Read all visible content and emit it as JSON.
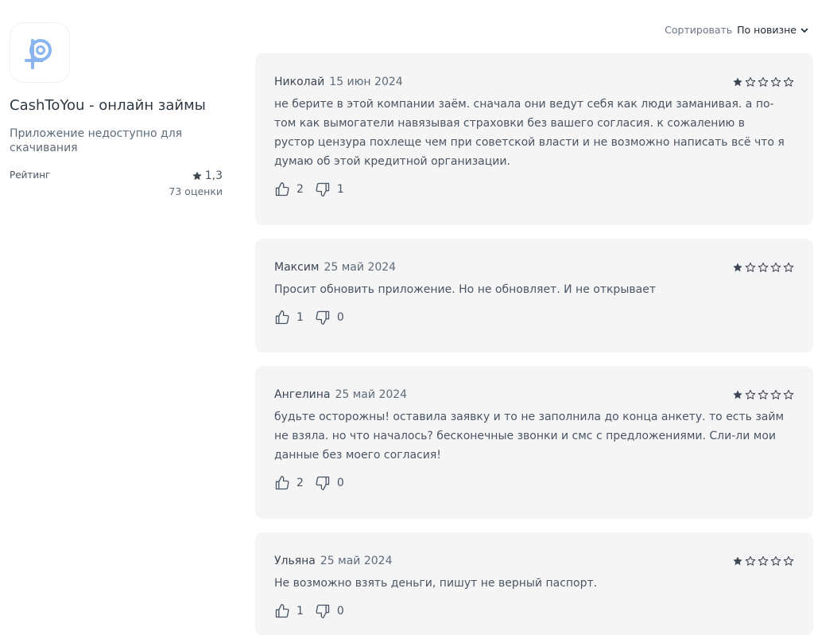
{
  "app": {
    "title": "CashToYou - онлайн займы",
    "status": "Приложение недоступно для скачивания",
    "rating_label": "Рейтинг",
    "rating_value": "1,3",
    "rating_count": "73 оценки",
    "icon": "cashtoyou-logo",
    "icon_color": "#8ab4f0"
  },
  "sort": {
    "label": "Сортировать",
    "value": "По новизне"
  },
  "reviews": [
    {
      "author": "Николай",
      "date": "15 июн 2024",
      "stars": 1,
      "text": "не берите в этой компании заём. сначала они ведут себя как люди заманивая. а по-том как вымогатели навязывая страховки без вашего согласия. к сожалению в рустор цензура похлеще чем при советской власти и не возможно написать всё что я думаю об этой кредитной организации.",
      "likes": "2",
      "dislikes": "1"
    },
    {
      "author": "Максим",
      "date": "25 май 2024",
      "stars": 1,
      "text": "Просит обновить приложение. Но не обновляет. И не открывает",
      "likes": "1",
      "dislikes": "0"
    },
    {
      "author": "Ангелина",
      "date": "25 май 2024",
      "stars": 1,
      "text": "будьте осторожны! оставила заявку и то не заполнила до конца анкету. то есть займ не взяла. но что началось? бесконечные звонки и смс с предложениями. Сли-ли мои данные без моего согласия!",
      "likes": "2",
      "dislikes": "0"
    },
    {
      "author": "Ульяна",
      "date": "25 май 2024",
      "stars": 1,
      "text": "Не возможно взять деньги, пишут не верный паспорт.",
      "likes": "1",
      "dislikes": "0"
    }
  ]
}
